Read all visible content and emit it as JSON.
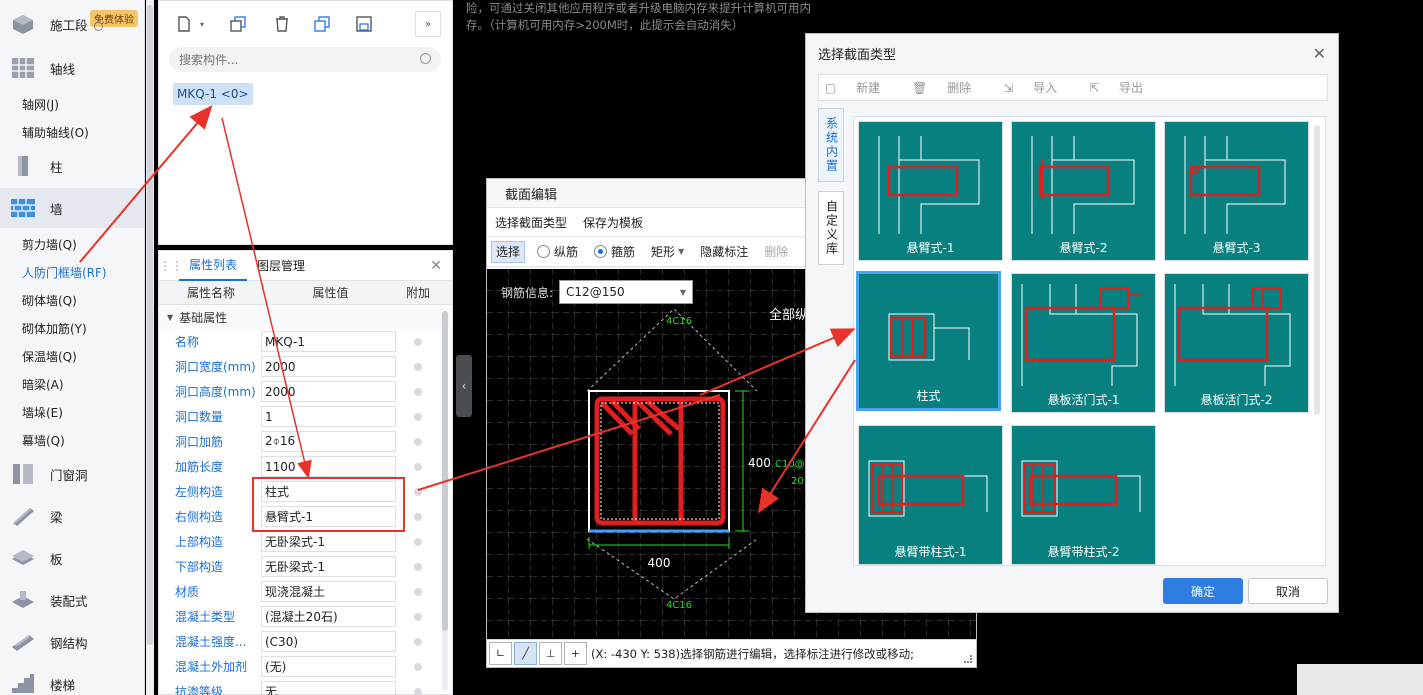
{
  "nav": {
    "top_item": "施工段",
    "free_badge": "免费体验",
    "categories": {
      "axis": "轴线",
      "column": "柱",
      "wall": "墙",
      "door_window": "门窗洞",
      "beam": "梁",
      "slab": "板",
      "prefab": "装配式",
      "steel": "钢结构",
      "stair": "楼梯"
    },
    "axis_items": [
      "轴网(J)",
      "辅助轴线(O)"
    ],
    "wall_items": [
      "剪力墙(Q)",
      "人防门框墙(RF)",
      "砌体墙(Q)",
      "砌体加筋(Y)",
      "保温墙(Q)",
      "暗梁(A)",
      "墙垛(E)",
      "幕墙(Q)"
    ]
  },
  "component": {
    "search_placeholder": "搜索构件...",
    "selected_item": "MKQ-1 <0>"
  },
  "props": {
    "tab_list": "属性列表",
    "tab_layer": "图层管理",
    "col_name": "属性名称",
    "col_value": "属性值",
    "col_add": "附加",
    "group": "基础属性",
    "rows": [
      {
        "name": "名称",
        "value": "MKQ-1"
      },
      {
        "name": "洞口宽度(mm)",
        "value": "2000"
      },
      {
        "name": "洞口高度(mm)",
        "value": "2000"
      },
      {
        "name": "洞口数量",
        "value": "1"
      },
      {
        "name": "洞口加筋",
        "value": "2⌽16"
      },
      {
        "name": "加筋长度",
        "value": "1100"
      },
      {
        "name": "左侧构造",
        "value": "柱式"
      },
      {
        "name": "右侧构造",
        "value": "悬臂式-1"
      },
      {
        "name": "上部构造",
        "value": "无卧梁式-1"
      },
      {
        "name": "下部构造",
        "value": "无卧梁式-1"
      },
      {
        "name": "材质",
        "value": "现浇混凝土"
      },
      {
        "name": "混凝土类型",
        "value": "(混凝土20石)"
      },
      {
        "name": "混凝土强度...",
        "value": "(C30)"
      },
      {
        "name": "混凝土外加剂",
        "value": "(无)"
      },
      {
        "name": "抗渗等级",
        "value": "无"
      }
    ]
  },
  "notice": {
    "line1": "险，可通过关闭其他应用程序或者升级电脑内存来提升计算机可用内",
    "line2": "存。（计算机可用内存>200M时，此提示会自动消失）"
  },
  "section_dialog": {
    "title": "截面编辑",
    "menu_select_type": "选择截面类型",
    "menu_save_template": "保存为模板",
    "tool_select": "选择",
    "tool_long_bar": "纵筋",
    "tool_stirrup": "箍筋",
    "tool_rect": "矩形",
    "tool_hide_label": "隐藏标注",
    "tool_delete": "删除",
    "rebar_info_label": "钢筋信息:",
    "rebar_value": "C12@150",
    "canvas_label_all": "全部纵",
    "dim_width": "400",
    "dim_height": "400",
    "bar_label_top": "4C16",
    "bar_label_bottom": "4C16",
    "dim_partial_1": "C10@",
    "dim_partial_2": "20",
    "status_text": "(X: -430 Y: 538)选择钢筋进行编辑，选择标注进行修改或移动;"
  },
  "type_dialog": {
    "title": "选择截面类型",
    "tb_new": "新建",
    "tb_delete": "删除",
    "tb_import": "导入",
    "tb_export": "导出",
    "side_system": "系统内置",
    "side_custom": "自定义库",
    "tiles": [
      "悬臂式-1",
      "悬臂式-2",
      "悬臂式-3",
      "柱式",
      "悬板活门式-1",
      "悬板活门式-2",
      "悬臂带柱式-1",
      "悬臂带柱式-2"
    ],
    "ok": "确定",
    "cancel": "取消"
  },
  "colors": {
    "accent": "#1a6fd0",
    "tile_bg": "#088080",
    "rebar_red": "#e02020",
    "annotation_arrow": "#e8322a"
  }
}
